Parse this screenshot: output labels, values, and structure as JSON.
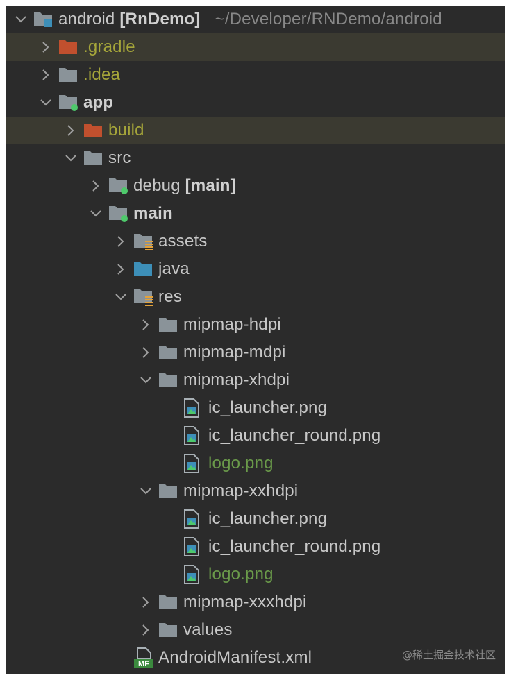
{
  "tree": {
    "root": {
      "name": "android",
      "module": "[RnDemo]",
      "path": "~/Developer/RNDemo/android"
    },
    "gradle": ".gradle",
    "idea": ".idea",
    "app": "app",
    "build": "build",
    "src": "src",
    "debug": {
      "name": "debug",
      "tag": "[main]"
    },
    "main": "main",
    "assets": "assets",
    "java": "java",
    "res": "res",
    "mipmap_hdpi": "mipmap-hdpi",
    "mipmap_mdpi": "mipmap-mdpi",
    "mipmap_xhdpi": "mipmap-xhdpi",
    "xhdpi_files": [
      "ic_launcher.png",
      "ic_launcher_round.png",
      "logo.png"
    ],
    "mipmap_xxhdpi": "mipmap-xxhdpi",
    "xxhdpi_files": [
      "ic_launcher.png",
      "ic_launcher_round.png",
      "logo.png"
    ],
    "mipmap_xxxhdpi": "mipmap-xxxhdpi",
    "values": "values",
    "manifest": "AndroidManifest.xml",
    "manifest_badge": "MF"
  },
  "watermark": "@稀土掘金技术社区",
  "colors": {
    "background": "#2b2b2b",
    "highlight_row": "#3b3a31",
    "excluded_folder": "#c1502e",
    "excluded_text": "#a6a63a",
    "folder": "#8a9399",
    "source_folder": "#3d8fb8",
    "new_file_text": "#6a9a4a",
    "module_dot": "#4ec96b"
  }
}
